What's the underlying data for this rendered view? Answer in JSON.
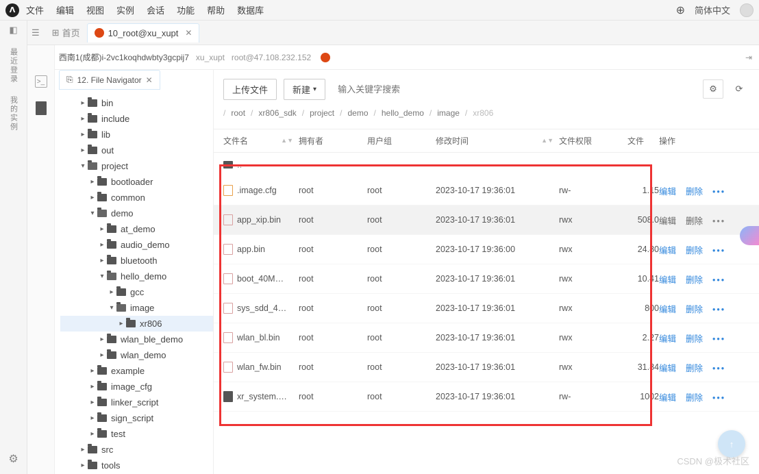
{
  "topmenu": {
    "file": "文件",
    "edit": "编辑",
    "view": "视图",
    "instance": "实例",
    "session": "会话",
    "function": "功能",
    "help": "帮助",
    "database": "数据库"
  },
  "topright": {
    "lang": "简体中文"
  },
  "tabs": {
    "home": "首页",
    "active": "10_root@xu_xupt"
  },
  "breadcrumb": {
    "host": "西南1(成都)i-2vc1koqhdwbty3gcpij7",
    "user": "xu_xupt",
    "conn": "root@47.108.232.152"
  },
  "leftrail": {
    "login": "最近登录",
    "instances": "我的实例"
  },
  "nav": {
    "tab": "12. File Navigator",
    "tree": [
      {
        "label": "bin",
        "ind": 2,
        "caret": "▸"
      },
      {
        "label": "include",
        "ind": 2,
        "caret": "▸"
      },
      {
        "label": "lib",
        "ind": 2,
        "caret": "▸"
      },
      {
        "label": "out",
        "ind": 2,
        "caret": "▸"
      },
      {
        "label": "project",
        "ind": 2,
        "caret": "▾",
        "open": true
      },
      {
        "label": "bootloader",
        "ind": 3,
        "caret": "▸"
      },
      {
        "label": "common",
        "ind": 3,
        "caret": "▸"
      },
      {
        "label": "demo",
        "ind": 3,
        "caret": "▾",
        "open": true
      },
      {
        "label": "at_demo",
        "ind": 4,
        "caret": "▸"
      },
      {
        "label": "audio_demo",
        "ind": 4,
        "caret": "▸"
      },
      {
        "label": "bluetooth",
        "ind": 4,
        "caret": "▸"
      },
      {
        "label": "hello_demo",
        "ind": 4,
        "caret": "▾",
        "open": true
      },
      {
        "label": "gcc",
        "ind": 5,
        "caret": "▸"
      },
      {
        "label": "image",
        "ind": 5,
        "caret": "▾",
        "open": true
      },
      {
        "label": "xr806",
        "ind": 6,
        "caret": "▸",
        "sel": true
      },
      {
        "label": "wlan_ble_demo",
        "ind": 4,
        "caret": "▸"
      },
      {
        "label": "wlan_demo",
        "ind": 4,
        "caret": "▸"
      },
      {
        "label": "example",
        "ind": 3,
        "caret": "▸"
      },
      {
        "label": "image_cfg",
        "ind": 3,
        "caret": "▸"
      },
      {
        "label": "linker_script",
        "ind": 3,
        "caret": "▸"
      },
      {
        "label": "sign_script",
        "ind": 3,
        "caret": "▸"
      },
      {
        "label": "test",
        "ind": 3,
        "caret": "▸"
      },
      {
        "label": "src",
        "ind": 2,
        "caret": "▸"
      },
      {
        "label": "tools",
        "ind": 2,
        "caret": "▸"
      }
    ]
  },
  "toolbar": {
    "upload": "上传文件",
    "new": "新建",
    "search_placeholder": "输入关键字搜索"
  },
  "path": {
    "segs": [
      "root",
      "xr806_sdk",
      "project",
      "demo",
      "hello_demo",
      "image"
    ],
    "current": "xr806"
  },
  "cols": {
    "name": "文件名",
    "owner": "拥有者",
    "group": "用户组",
    "mtime": "修改时间",
    "perm": "文件权限",
    "size": "文件",
    "act": "操作"
  },
  "files": [
    {
      "name": ".image.cfg",
      "owner": "root",
      "group": "root",
      "mtime": "2023-10-17 19:36:01",
      "perm": "rw-",
      "size": "1.15",
      "icon": "cfg"
    },
    {
      "name": "app_xip.bin",
      "owner": "root",
      "group": "root",
      "mtime": "2023-10-17 19:36:01",
      "perm": "rwx",
      "size": "508.0",
      "sel": true
    },
    {
      "name": "app.bin",
      "owner": "root",
      "group": "root",
      "mtime": "2023-10-17 19:36:00",
      "perm": "rwx",
      "size": "24.80"
    },
    {
      "name": "boot_40M…",
      "owner": "root",
      "group": "root",
      "mtime": "2023-10-17 19:36:01",
      "perm": "rwx",
      "size": "10.41"
    },
    {
      "name": "sys_sdd_4…",
      "owner": "root",
      "group": "root",
      "mtime": "2023-10-17 19:36:01",
      "perm": "rwx",
      "size": "800"
    },
    {
      "name": "wlan_bl.bin",
      "owner": "root",
      "group": "root",
      "mtime": "2023-10-17 19:36:01",
      "perm": "rwx",
      "size": "2.27"
    },
    {
      "name": "wlan_fw.bin",
      "owner": "root",
      "group": "root",
      "mtime": "2023-10-17 19:36:01",
      "perm": "rwx",
      "size": "31.84"
    },
    {
      "name": "xr_system.…",
      "owner": "root",
      "group": "root",
      "mtime": "2023-10-17 19:36:01",
      "perm": "rw-",
      "size": "1002",
      "icon": "bin"
    }
  ],
  "actions": {
    "edit": "编辑",
    "delete": "删除"
  },
  "watermark": "CSDN @极术社区"
}
